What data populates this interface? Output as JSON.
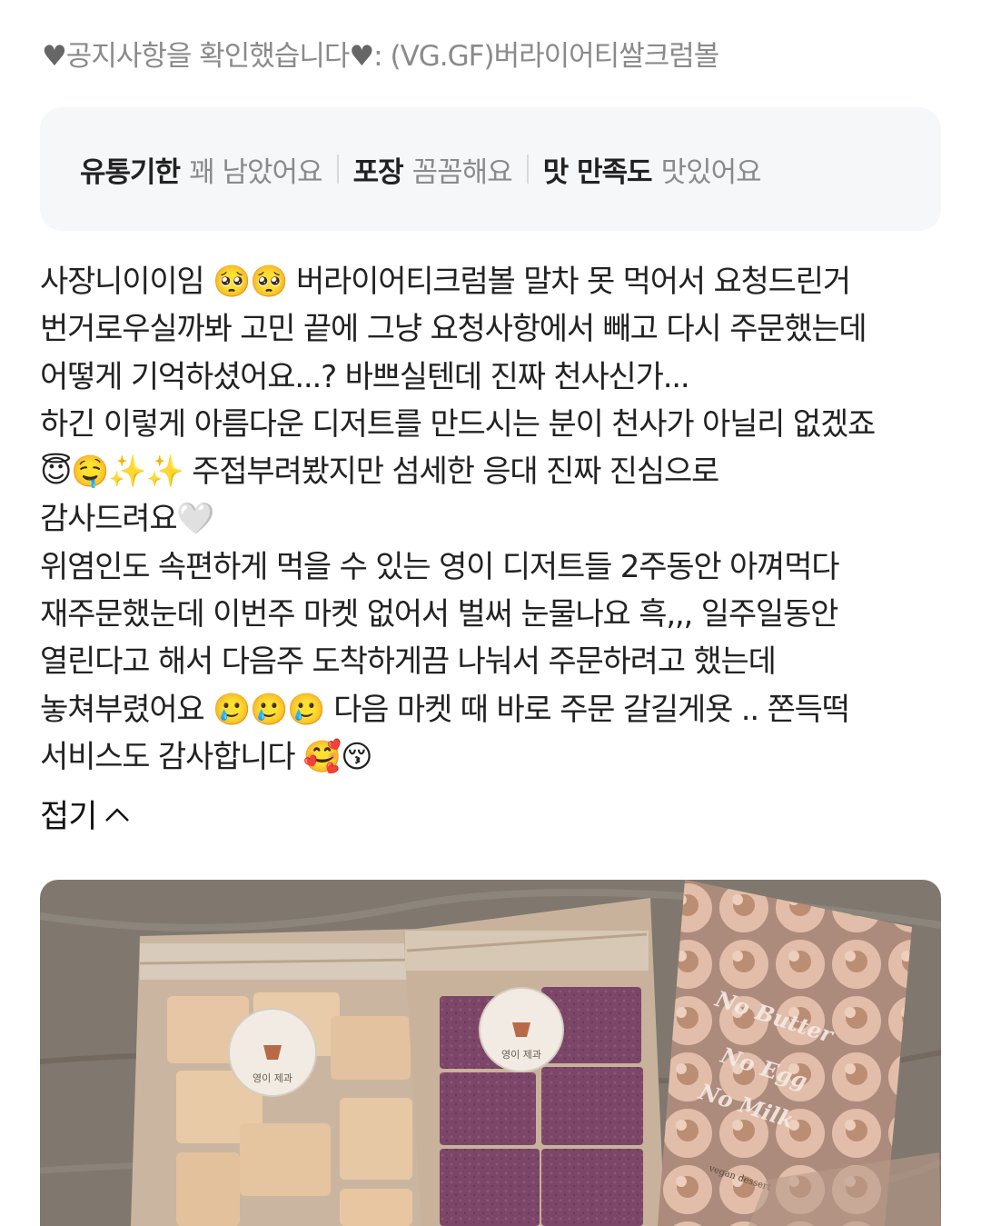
{
  "option": {
    "heart_left": "♥",
    "text": "공지사항을 확인했습니다",
    "heart_right": "♥",
    "suffix": ": (VG.GF)버라이어티쌀크럼볼"
  },
  "summary": [
    {
      "key": "유통기한",
      "value": "꽤 남았어요"
    },
    {
      "key": "포장",
      "value": "꼼꼼해요"
    },
    {
      "key": "맛 만족도",
      "value": "맛있어요"
    }
  ],
  "review_lines": [
    "사장니이이임 🥺🥺 버라이어티크럼볼 말차 못 먹어서 요청드린거",
    "번거로우실까봐 고민 끝에 그냥 요청사항에서 빼고 다시 주문했는데",
    "어떻게 기억하셨어요...? 바쁘실텐데 진짜 천사신가...",
    "하긴 이렇게 아름다운 디저트를 만드시는 분이 천사가 아닐리 없겠죠",
    "😇🤤✨✨ 주접부려봤지만 섬세한 응대 진짜 진심으로",
    "감사드려요🤍",
    "위염인도 속편하게 먹을 수 있는 영이 디저트들 2주동안 아껴먹다",
    "재주문했눈데 이번주 마켓 없어서 벌써 눈물나요 흑,,, 일주일동안",
    "열린다고 해서 다음주 도착하게끔 나눠서 주문하려고 했는데",
    "놓쳐부렸어요 🥲🥲🥲 다음 마켓 때 바로 주문 갈길게욧 .. 쫀득떡",
    "서비스도 감사합니다 🥰😚"
  ],
  "fold_label": "접기",
  "photo": {
    "sticker_text": "영이 제과",
    "bag_text": [
      "No Butter",
      "No Egg",
      "No Milk"
    ],
    "bag_small_text": "vegan dessert"
  }
}
